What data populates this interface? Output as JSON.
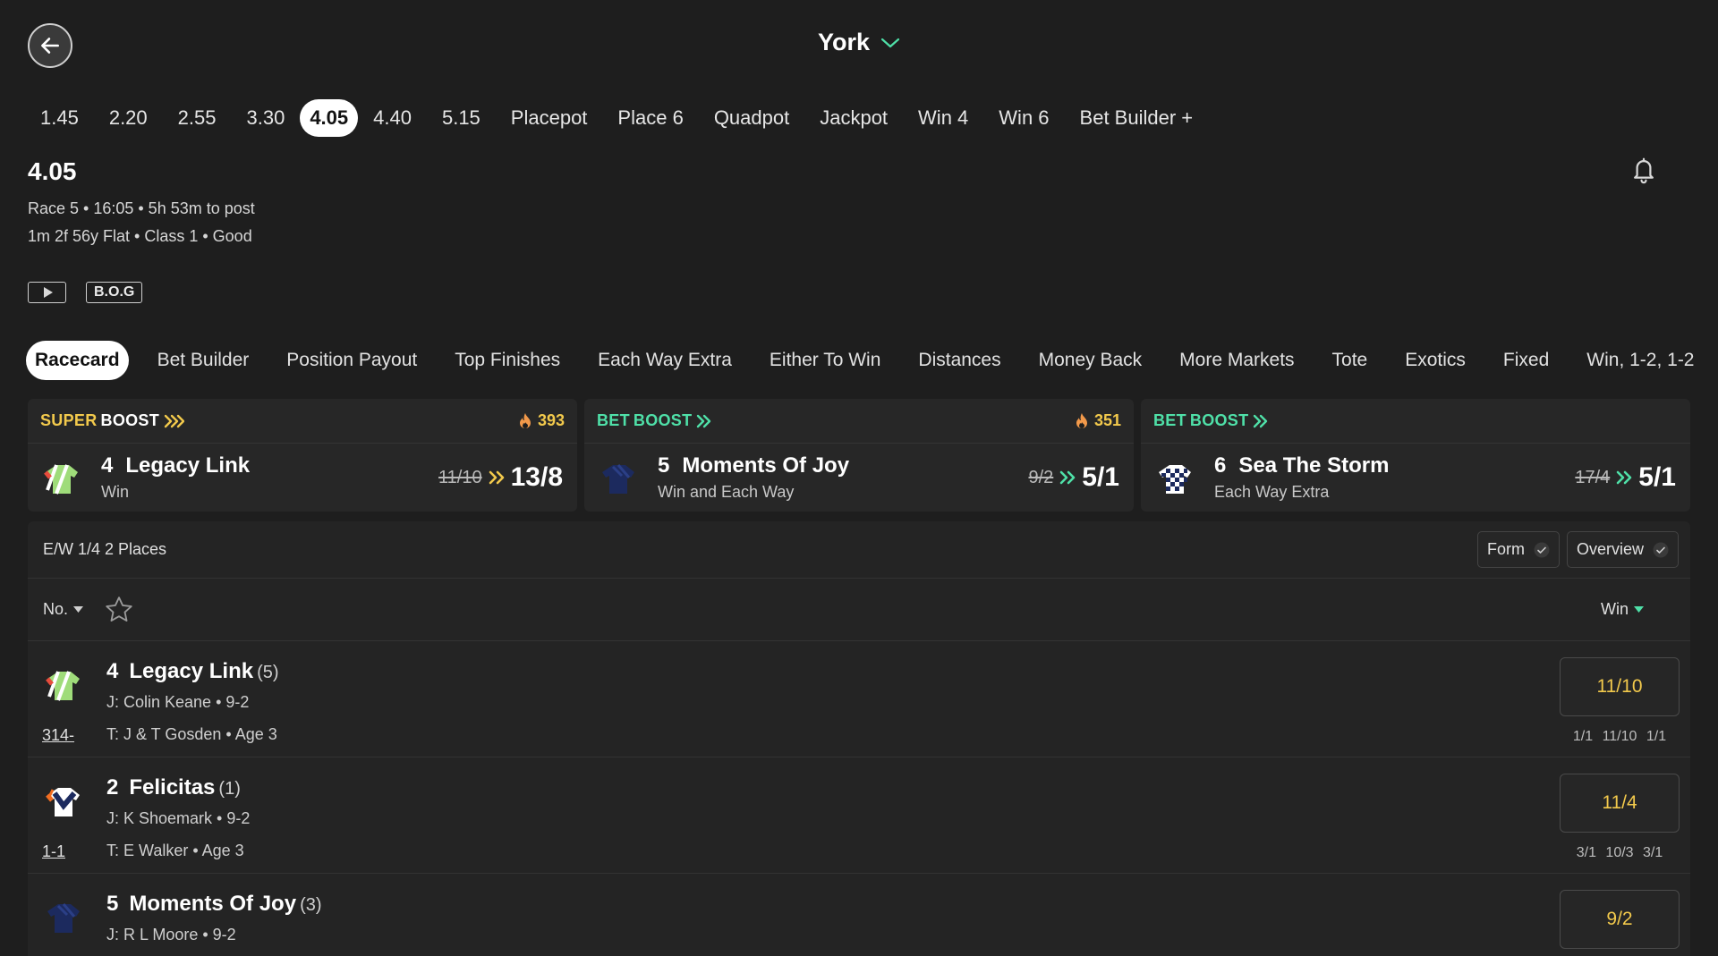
{
  "header": {
    "venue": "York"
  },
  "race_times": [
    "1.45",
    "2.20",
    "2.55",
    "3.30",
    "4.05",
    "4.40",
    "5.15",
    "Placepot",
    "Place 6",
    "Quadpot",
    "Jackpot",
    "Win 4",
    "Win 6",
    "Bet Builder +"
  ],
  "active_race_time": "4.05",
  "race": {
    "title": "4.05",
    "info_line1": "Race 5 • 16:05 • 5h 53m to post",
    "info_line2": "1m 2f 56y Flat  • Class 1  • Good",
    "bog_label": "B.O.G"
  },
  "market_tabs": [
    "Racecard",
    "Bet Builder",
    "Position Payout",
    "Top Finishes",
    "Each Way Extra",
    "Either To Win",
    "Distances",
    "Money Back",
    "More Markets",
    "Tote",
    "Exotics",
    "Fixed",
    "Win, 1-2, 1-2"
  ],
  "boosts": [
    {
      "label_part1": "SUPER",
      "label_part2": "BOOST",
      "count": "393",
      "number": "4",
      "name": "Legacy Link",
      "market": "Win",
      "old_odds": "11/10",
      "new_odds": "13/8"
    },
    {
      "label_part1": "BET",
      "label_part2": "BOOST",
      "count": "351",
      "number": "5",
      "name": "Moments Of Joy",
      "market": "Win and Each Way",
      "old_odds": "9/2",
      "new_odds": "5/1"
    },
    {
      "label_part1": "BET",
      "label_part2": "BOOST",
      "count": "",
      "number": "6",
      "name": "Sea The Storm",
      "market": "Each Way Extra",
      "old_odds": "17/4",
      "new_odds": "5/1"
    }
  ],
  "racecard": {
    "each_way_terms": "E/W 1/4 2 Places",
    "form_toggle": "Form",
    "overview_toggle": "Overview",
    "sort_label": "No.",
    "price_label": "Win",
    "runners": [
      {
        "number": "4",
        "name": "Legacy Link",
        "draw": "(5)",
        "jockey": "J: Colin Keane • 9-2",
        "trainer": "T: J & T Gosden • Age 3",
        "form": "314-",
        "odds": "11/10",
        "previous_odds": "1/1 11/10 1/1"
      },
      {
        "number": "2",
        "name": "Felicitas",
        "draw": "(1)",
        "jockey": "J: K Shoemark • 9-2",
        "trainer": "T: E Walker • Age 3",
        "form": "1-1",
        "odds": "11/4",
        "previous_odds": "3/1 10/3 3/1"
      },
      {
        "number": "5",
        "name": "Moments Of Joy",
        "draw": "(3)",
        "jockey": "J: R L Moore • 9-2",
        "trainer": "",
        "form": "",
        "odds": "9/2",
        "previous_odds": ""
      }
    ]
  },
  "colors": {
    "background": "#1e1e1e",
    "card": "#272727",
    "odds_yellow": "#f2c94c",
    "boost_green": "#4fe0a8",
    "boost_yellow": "#f2c94c"
  },
  "icons": [
    "arrow-left-icon",
    "chevron-down-icon",
    "bell-icon",
    "play-icon",
    "flame-icon",
    "double-chevron-icon",
    "check-icon",
    "star-icon",
    "caret-down-icon",
    "jockey-silk-icon"
  ]
}
